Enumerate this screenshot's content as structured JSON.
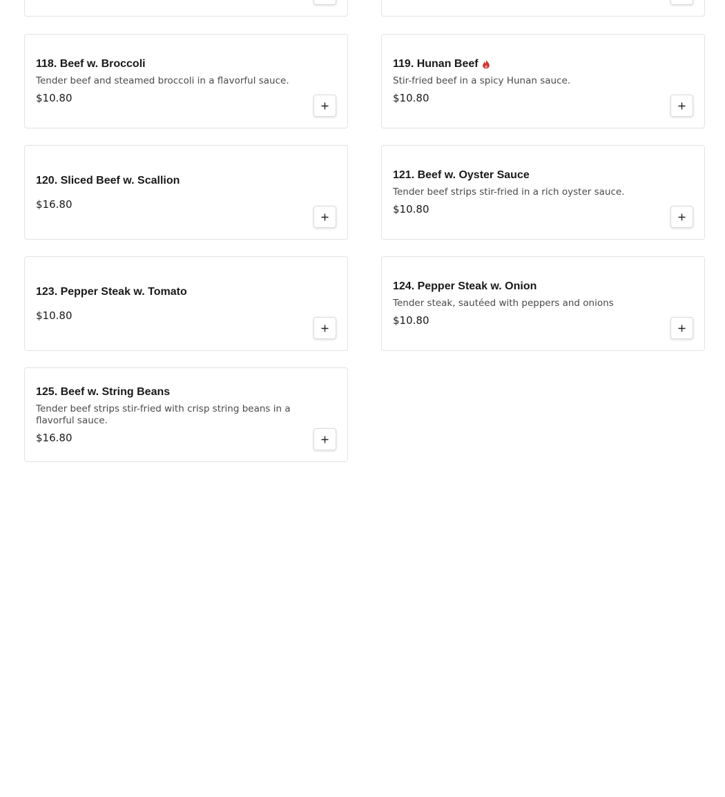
{
  "menu_items": [
    {
      "name": "118. Beef w. Broccoli",
      "description": "Tender beef and steamed broccoli in a flavorful sauce.",
      "price": "$10.80",
      "spicy": false
    },
    {
      "name": "119. Hunan Beef",
      "description": "Stir-fried beef in a spicy Hunan sauce.",
      "price": "$10.80",
      "spicy": true
    },
    {
      "name": "120. Sliced Beef w. Scallion",
      "description": "",
      "price": "$16.80",
      "spicy": false
    },
    {
      "name": "121. Beef w. Oyster Sauce",
      "description": "Tender beef strips stir-fried in a rich oyster sauce.",
      "price": "$10.80",
      "spicy": false
    },
    {
      "name": "123. Pepper Steak w. Tomato",
      "description": "",
      "price": "$10.80",
      "spicy": false
    },
    {
      "name": "124. Pepper Steak w. Onion",
      "description": "Tender steak, sautéed with peppers and onions",
      "price": "$10.80",
      "spicy": false
    },
    {
      "name": "125. Beef w. String Beans",
      "description": "Tender beef strips stir-fried with crisp string beans in a flavorful sauce.",
      "price": "$16.80",
      "spicy": false
    }
  ],
  "icons": {
    "add": "plus-icon",
    "spicy": "flame-icon"
  },
  "colors": {
    "spicy": "#d0312d",
    "border": "#e3e3e3"
  }
}
